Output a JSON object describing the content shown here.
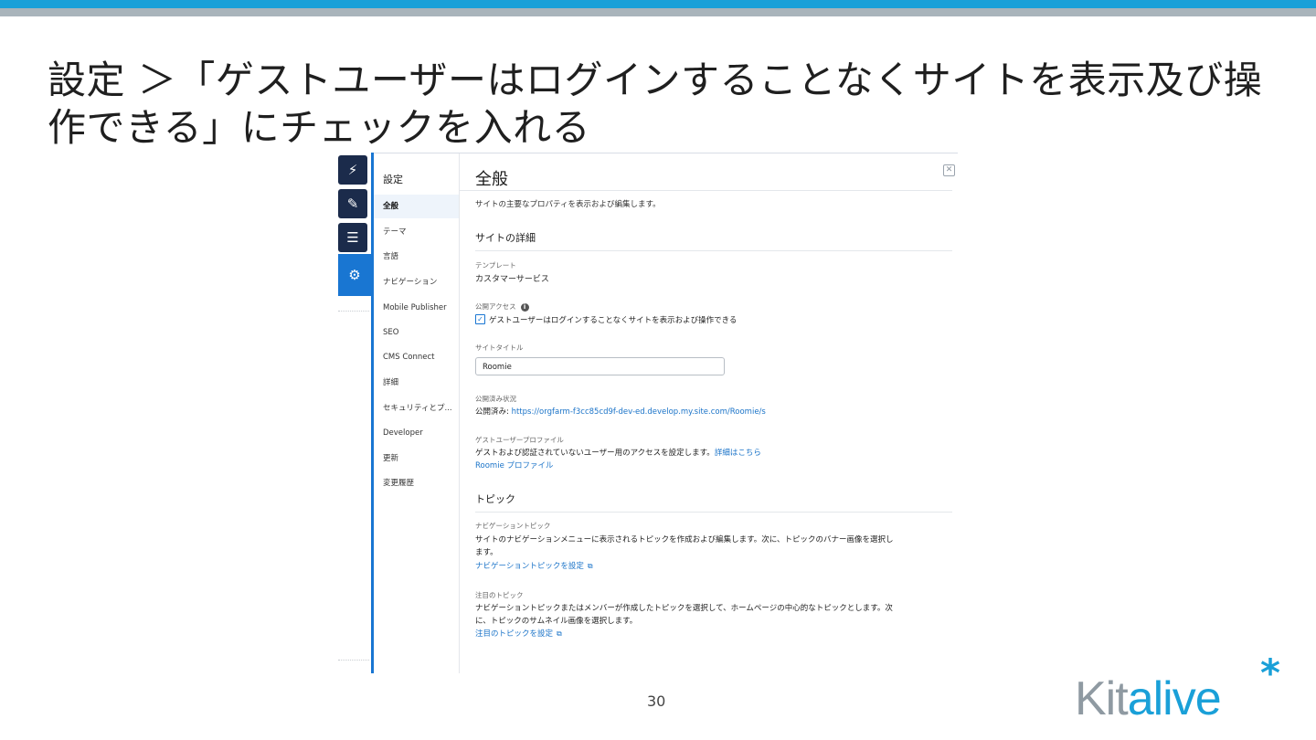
{
  "slide": {
    "title": "設定 ＞「ゲストユーザーはログインすることなくサイトを表示及び操作できる」にチェックを入れる",
    "page_number": "30",
    "logo": {
      "text_a": "Kit",
      "text_b": "alive",
      "star": "*",
      "colors": {
        "gray": "#8f9aa2",
        "blue": "#1aa0d8"
      }
    },
    "colors": {
      "top_bar": "#1aa0d8",
      "top_bar_secondary": "#a9b4bb"
    }
  },
  "rail": {
    "buttons": [
      {
        "icon": "lightning-icon",
        "glyph": "⚡"
      },
      {
        "icon": "brush-icon",
        "glyph": "✎"
      },
      {
        "icon": "pages-icon",
        "glyph": "☰"
      },
      {
        "icon": "gear-icon",
        "glyph": "⚙"
      }
    ]
  },
  "settings_nav": {
    "title": "設定",
    "items": [
      {
        "label": "全般"
      },
      {
        "label": "テーマ"
      },
      {
        "label": "言語"
      },
      {
        "label": "ナビゲーション"
      },
      {
        "label": "Mobile Publisher"
      },
      {
        "label": "SEO"
      },
      {
        "label": "CMS Connect"
      },
      {
        "label": "詳細"
      },
      {
        "label": "セキュリティとプ..."
      },
      {
        "label": "Developer"
      },
      {
        "label": "更新"
      },
      {
        "label": "変更履歴"
      }
    ],
    "active": "全般"
  },
  "general": {
    "title": "全般",
    "description": "サイトの主要なプロパティを表示および編集します。",
    "site_details": {
      "heading": "サイトの詳細",
      "template_label": "テンプレート",
      "template_value": "カスタマーサービス",
      "public_access_label": "公開アクセス",
      "guest_checkbox_label": "ゲストユーザーはログインすることなくサイトを表示および操作できる",
      "guest_checkbox_checked": true,
      "site_title_label": "サイトタイトル",
      "site_title_value": "Roomie",
      "published_status_label": "公開済み状況",
      "published_prefix": "公開済み: ",
      "published_url": "https://orgfarm-f3cc85cd9f-dev-ed.develop.my.site.com/Roomie/s",
      "guest_profile_label": "ゲストユーザープロファイル",
      "guest_profile_desc": "ゲストおよび認証されていないユーザー用のアクセスを設定します。",
      "guest_profile_more_link": "詳細はこちら",
      "guest_profile_link": "Roomie プロファイル"
    },
    "topics": {
      "heading": "トピック",
      "nav_topics_label": "ナビゲーショントピック",
      "nav_topics_desc_line1": "サイトのナビゲーションメニューに表示されるトピックを作成および編集します。次に、トピックのバナー画像を選択し",
      "nav_topics_desc_line2": "ます。",
      "nav_topics_link": "ナビゲーショントピックを設定",
      "featured_topics_label": "注目のトピック",
      "featured_topics_desc_line1": "ナビゲーショントピックまたはメンバーが作成したトピックを選択して、ホームページの中心的なトピックとします。次",
      "featured_topics_desc_line2": "に、トピックのサムネイル画像を選択します。",
      "featured_topics_link": "注目のトピックを設定"
    }
  }
}
